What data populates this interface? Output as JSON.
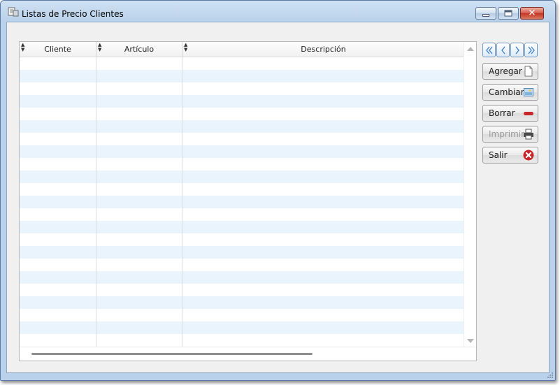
{
  "window": {
    "title": "Listas de Precio Clientes",
    "controls": {
      "minimize": "",
      "maximize": "",
      "close": "✕"
    }
  },
  "grid": {
    "columns": [
      {
        "label": "Cliente"
      },
      {
        "label": "Artículo"
      },
      {
        "label": "Descripción"
      }
    ],
    "rows": []
  },
  "navigation": [
    "first-icon",
    "previous-icon",
    "next-icon",
    "last-icon"
  ],
  "actions": {
    "agregar": {
      "label": "Agregar",
      "icon": "new-document-icon",
      "enabled": true
    },
    "cambiar": {
      "label": "Cambiar",
      "icon": "edit-picture-icon",
      "enabled": true
    },
    "borrar": {
      "label": "Borrar",
      "icon": "remove-icon",
      "enabled": true
    },
    "imprimir": {
      "label": "Imprimir",
      "icon": "printer-icon",
      "enabled": false
    },
    "salir": {
      "label": "Salir",
      "icon": "close-circle-icon",
      "enabled": true
    }
  },
  "colors": {
    "row_alt": "#eaf4fc",
    "nav_accent": "#3c7fc8",
    "borrar_icon": "#c8262a",
    "salir_icon": "#c8262a"
  }
}
